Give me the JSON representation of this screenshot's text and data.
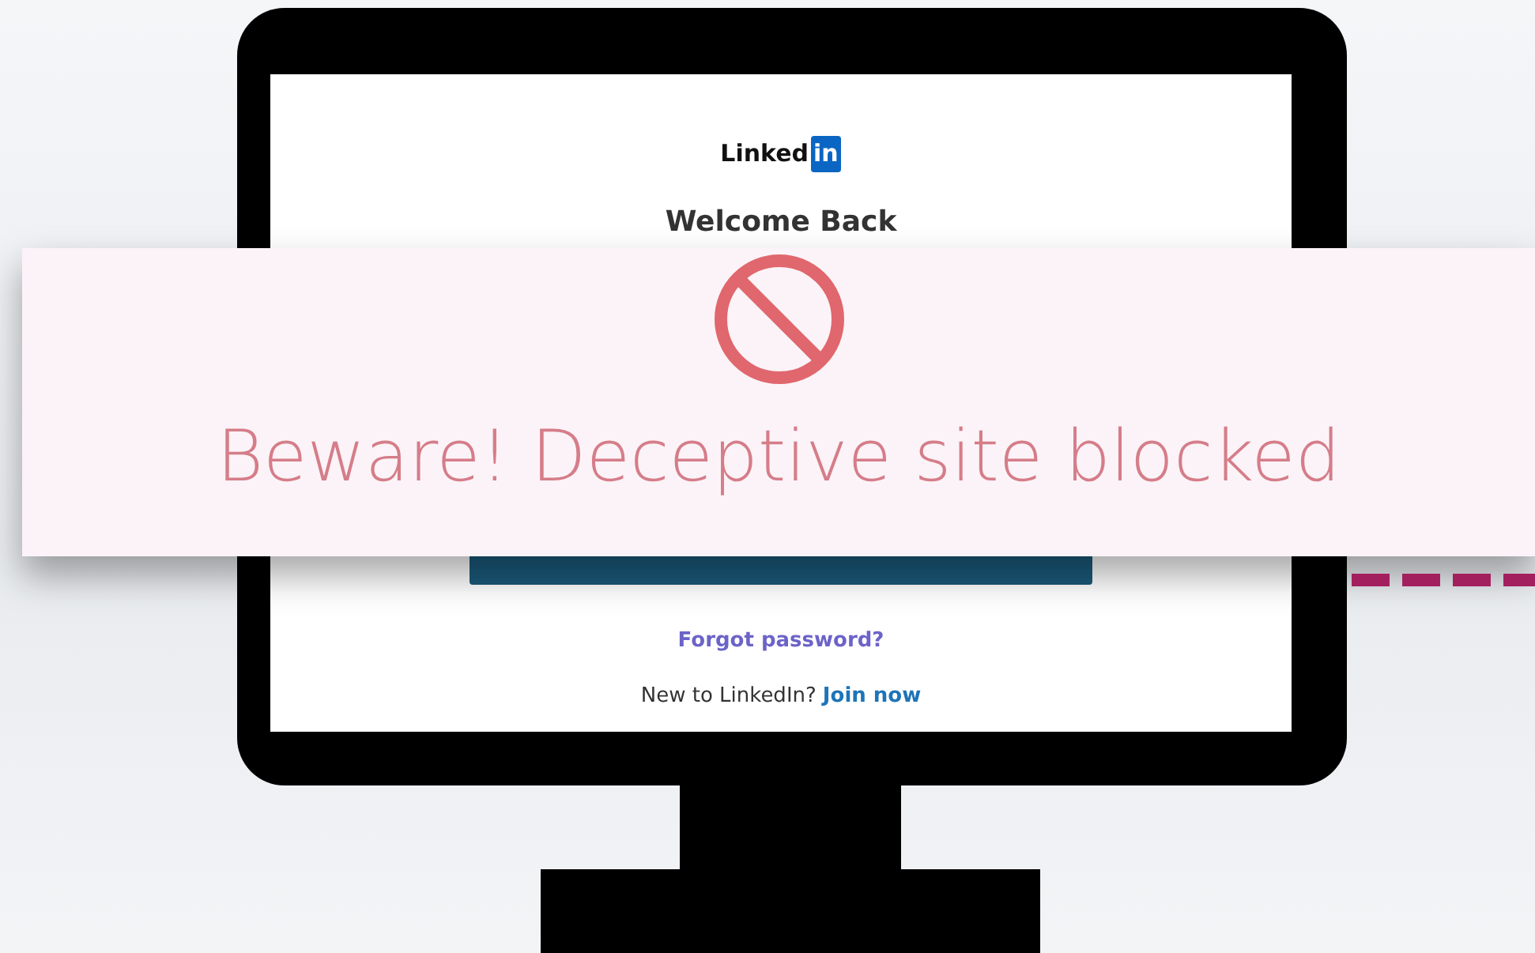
{
  "logo": {
    "text": "Linked",
    "badge": "in"
  },
  "heading": "Welcome Back",
  "forgot_link": "Forgot password?",
  "signup": {
    "text": "New to LinkedIn?",
    "link": "Join now"
  },
  "warning_banner": {
    "title": "Beware! Deceptive site blocked"
  }
}
